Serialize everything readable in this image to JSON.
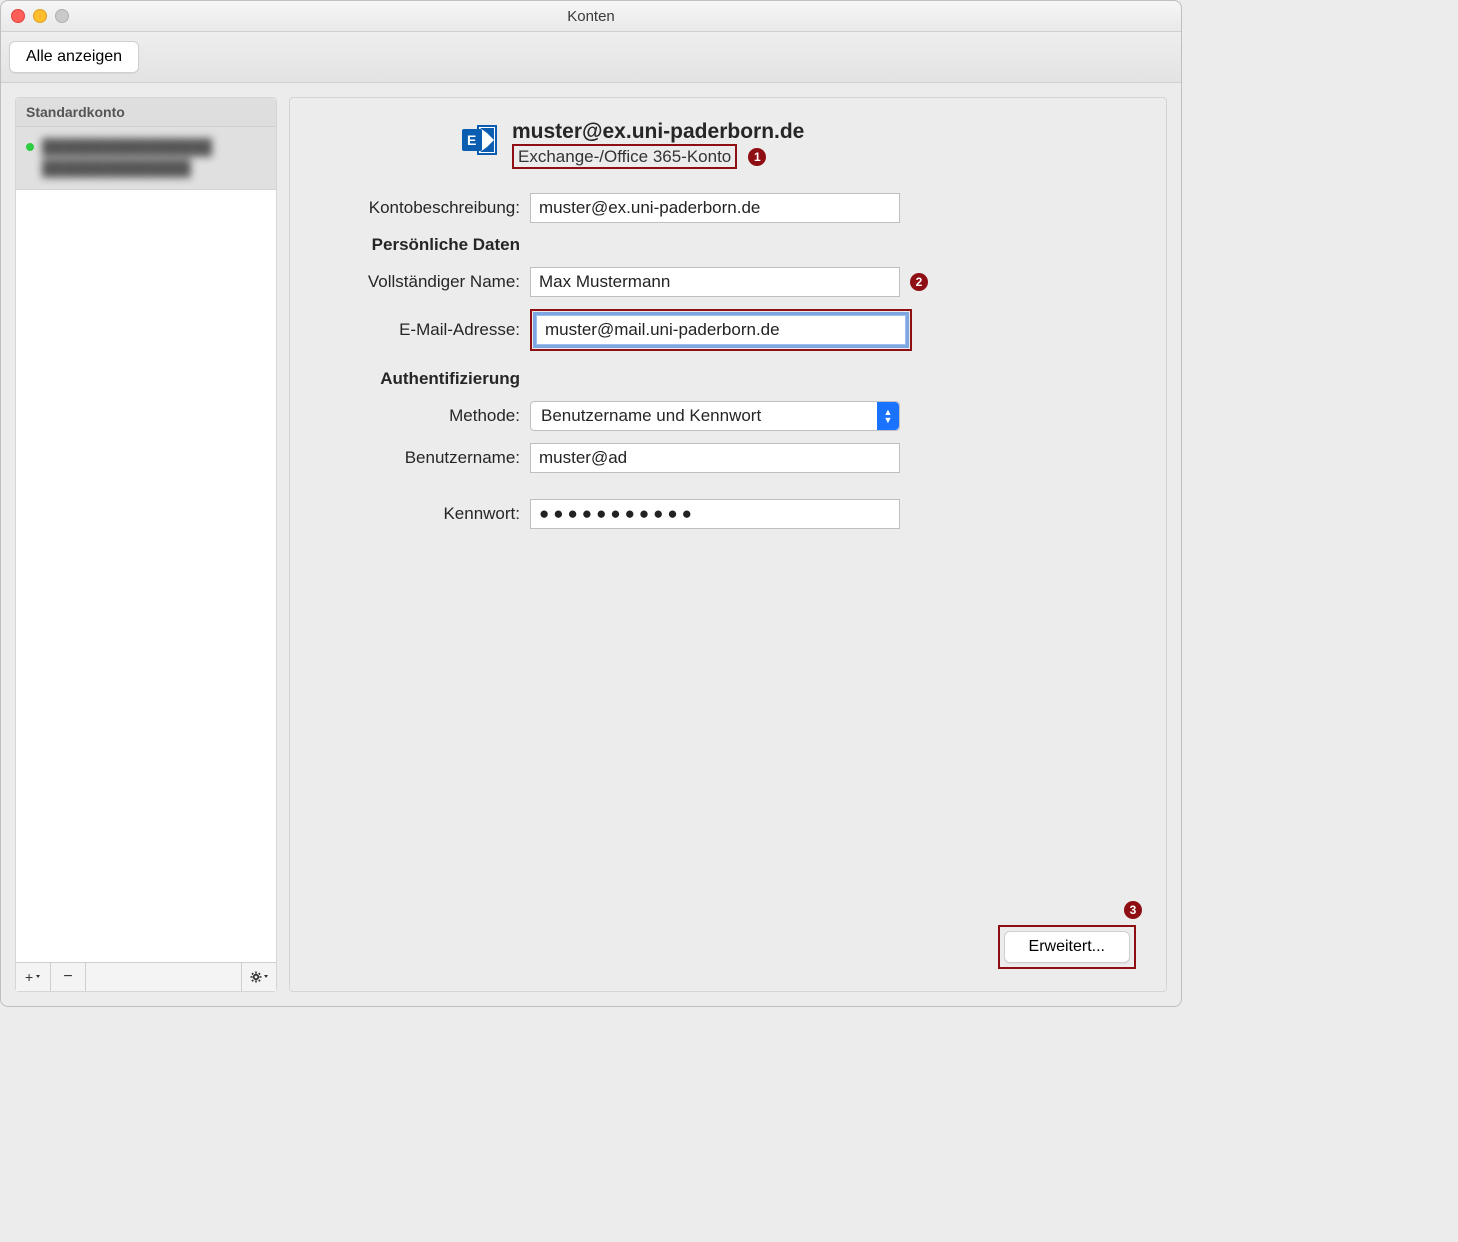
{
  "window": {
    "title": "Konten"
  },
  "toolbar": {
    "show_all": "Alle anzeigen"
  },
  "sidebar": {
    "header": "Standardkonto",
    "default_account": {
      "line1": "████████████████",
      "line2": "██████████████"
    },
    "footer": {
      "add_label": "+",
      "remove_label": "−"
    }
  },
  "account": {
    "title": "muster@ex.uni-paderborn.de",
    "subtitle": "Exchange-/Office 365-Konto"
  },
  "labels": {
    "description": "Kontobeschreibung:",
    "personal_header": "Persönliche Daten",
    "full_name": "Vollständiger Name:",
    "email": "E-Mail-Adresse:",
    "auth_header": "Authentifizierung",
    "method": "Methode:",
    "username": "Benutzername:",
    "password": "Kennwort:"
  },
  "fields": {
    "description": "muster@ex.uni-paderborn.de",
    "full_name": "Max Mustermann",
    "email": "muster@mail.uni-paderborn.de",
    "method_selected": "Benutzername und Kennwort",
    "username": "muster@ad",
    "password_display": "●●●●●●●●●●●"
  },
  "footer": {
    "advanced": "Erweitert..."
  },
  "annotations": {
    "a1": "1",
    "a2": "2",
    "a3": "3"
  }
}
